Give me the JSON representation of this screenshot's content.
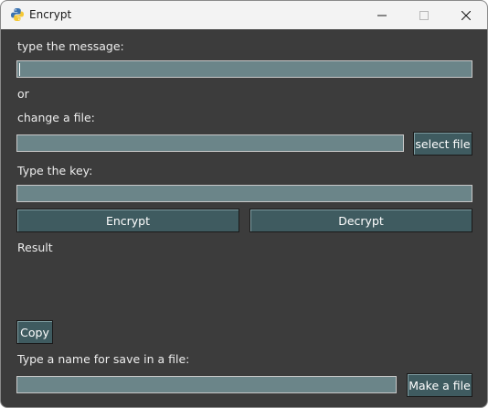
{
  "window": {
    "title": "Encrypt",
    "icons": {
      "app": "python-icon",
      "minimize": "minimize-icon",
      "maximize": "maximize-icon",
      "close": "close-icon"
    }
  },
  "message": {
    "label": "type the message:",
    "value": ""
  },
  "or_text": "or",
  "file": {
    "label": "change a file:",
    "value": "",
    "button": "select file"
  },
  "key": {
    "label": "Type the key:",
    "value": ""
  },
  "actions": {
    "encrypt": "Encrypt",
    "decrypt": "Decrypt"
  },
  "result": {
    "label": "Result",
    "value": ""
  },
  "copy_button": "Copy",
  "save": {
    "label": "Type a name for save in a file:",
    "value": "",
    "button": "Make a file"
  },
  "colors": {
    "background": "#3c3c3c",
    "entry": "#6b8589",
    "button": "#3f5b60"
  }
}
